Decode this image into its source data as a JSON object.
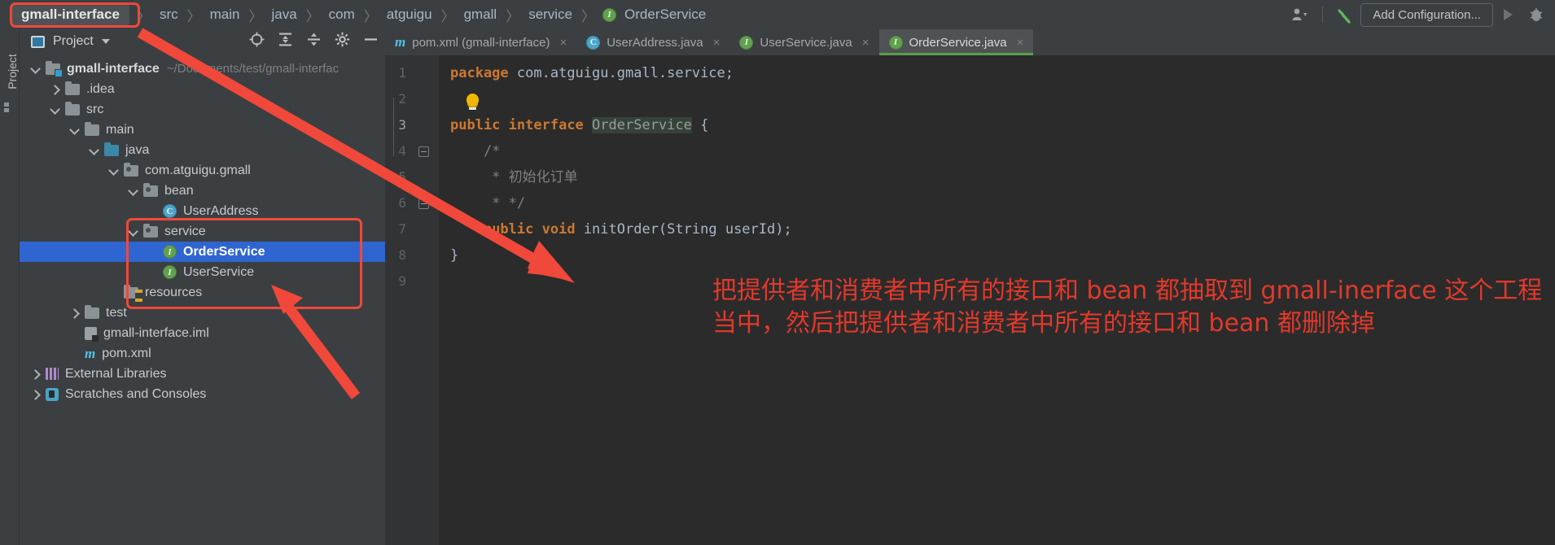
{
  "toolbar": {
    "breadcrumbs": [
      {
        "label": "gmall-interface",
        "icon": "",
        "root": true
      },
      {
        "label": "src",
        "icon": ""
      },
      {
        "label": "main",
        "icon": ""
      },
      {
        "label": "java",
        "icon": ""
      },
      {
        "label": "com",
        "icon": ""
      },
      {
        "label": "atguigu",
        "icon": ""
      },
      {
        "label": "gmall",
        "icon": ""
      },
      {
        "label": "service",
        "icon": ""
      },
      {
        "label": "OrderService",
        "icon": "interface-icon"
      }
    ],
    "user_icon": "user-dropdown-icon",
    "build_icon": "build-hammer-icon",
    "add_configuration_label": "Add Configuration...",
    "run_icon": "run-triangle-icon",
    "debug_icon": "debug-bug-icon"
  },
  "toolstrip": {
    "vertical_label": "Project",
    "structure_icon": "structure-icon"
  },
  "project_panel": {
    "title": "Project",
    "window_icon": "project-window-icon",
    "caret_icon": "chevron-down-icon",
    "actions": [
      {
        "name": "scroll-from-source-icon",
        "glyph": "target"
      },
      {
        "name": "expand-all-icon",
        "glyph": "expand"
      },
      {
        "name": "collapse-all-icon",
        "glyph": "collapse"
      },
      {
        "name": "settings-gear-icon",
        "glyph": "gear"
      },
      {
        "name": "hide-panel-icon",
        "glyph": "minus"
      }
    ],
    "tree": [
      {
        "label": "gmall-interface",
        "path": "~/Documents/test/gmall-interfac",
        "depth": 0,
        "arrow": "down",
        "icon": "module-folder",
        "bold": true,
        "selected": false
      },
      {
        "label": ".idea",
        "path": "",
        "depth": 1,
        "arrow": "right",
        "icon": "folder",
        "bold": false,
        "selected": false
      },
      {
        "label": "src",
        "path": "",
        "depth": 1,
        "arrow": "down",
        "icon": "folder",
        "bold": false,
        "selected": false
      },
      {
        "label": "main",
        "path": "",
        "depth": 2,
        "arrow": "down",
        "icon": "folder",
        "bold": false,
        "selected": false
      },
      {
        "label": "java",
        "path": "",
        "depth": 3,
        "arrow": "down",
        "icon": "source-folder",
        "bold": false,
        "selected": false
      },
      {
        "label": "com.atguigu.gmall",
        "path": "",
        "depth": 4,
        "arrow": "down",
        "icon": "package-folder",
        "bold": false,
        "selected": false
      },
      {
        "label": "bean",
        "path": "",
        "depth": 5,
        "arrow": "down",
        "icon": "package-folder",
        "bold": false,
        "selected": false
      },
      {
        "label": "UserAddress",
        "path": "",
        "depth": 6,
        "arrow": "none",
        "icon": "class-icon",
        "bold": false,
        "selected": false
      },
      {
        "label": "service",
        "path": "",
        "depth": 5,
        "arrow": "down",
        "icon": "package-folder",
        "bold": false,
        "selected": false
      },
      {
        "label": "OrderService",
        "path": "",
        "depth": 6,
        "arrow": "none",
        "icon": "interface-icon",
        "bold": true,
        "selected": true
      },
      {
        "label": "UserService",
        "path": "",
        "depth": 6,
        "arrow": "none",
        "icon": "interface-icon",
        "bold": false,
        "selected": false
      },
      {
        "label": "resources",
        "path": "",
        "depth": 4,
        "arrow": "none",
        "icon": "resources-folder",
        "bold": false,
        "selected": false
      },
      {
        "label": "test",
        "path": "",
        "depth": 2,
        "arrow": "right",
        "icon": "folder",
        "bold": false,
        "selected": false
      },
      {
        "label": "gmall-interface.iml",
        "path": "",
        "depth": 2,
        "arrow": "none",
        "icon": "iml-file",
        "bold": false,
        "selected": false
      },
      {
        "label": "pom.xml",
        "path": "",
        "depth": 2,
        "arrow": "none",
        "icon": "maven-icon",
        "bold": false,
        "selected": false
      },
      {
        "label": "External Libraries",
        "path": "",
        "depth": 0,
        "arrow": "right",
        "icon": "library-icon",
        "bold": false,
        "selected": false
      },
      {
        "label": "Scratches and Consoles",
        "path": "",
        "depth": 0,
        "arrow": "right",
        "icon": "scratch-icon",
        "bold": false,
        "selected": false
      }
    ]
  },
  "editor": {
    "tabs": [
      {
        "label": "pom.xml (gmall-interface)",
        "icon": "maven-icon",
        "active": false
      },
      {
        "label": "UserAddress.java",
        "icon": "class-icon",
        "active": false
      },
      {
        "label": "UserService.java",
        "icon": "interface-icon",
        "active": false
      },
      {
        "label": "OrderService.java",
        "icon": "interface-icon",
        "active": true
      }
    ],
    "close_glyph": "×",
    "line_numbers": [
      "1",
      "2",
      "3",
      "4",
      "5",
      "6",
      "7",
      "8",
      "9"
    ],
    "lines": [
      {
        "n": "1",
        "segments": [
          {
            "t": "package",
            "c": "kw"
          },
          {
            "t": " ",
            "c": "plain"
          },
          {
            "t": "com.atguigu.gmall.service;",
            "c": "plain"
          }
        ]
      },
      {
        "n": "2",
        "segments": [],
        "bulb": true
      },
      {
        "n": "3",
        "segments": [
          {
            "t": "public",
            "c": "kw"
          },
          {
            "t": " ",
            "c": "plain"
          },
          {
            "t": "interface",
            "c": "kw"
          },
          {
            "t": " ",
            "c": "plain"
          },
          {
            "t": "OrderService",
            "c": "id-hl"
          },
          {
            "t": " {",
            "c": "plain"
          }
        ]
      },
      {
        "n": "4",
        "segments": [
          {
            "t": "    /*",
            "c": "cmt"
          }
        ]
      },
      {
        "n": "5",
        "segments": [
          {
            "t": "     * 初始化订单",
            "c": "cmt"
          }
        ]
      },
      {
        "n": "6",
        "segments": [
          {
            "t": "     * */",
            "c": "cmt"
          }
        ]
      },
      {
        "n": "7",
        "segments": [
          {
            "t": "    ",
            "c": "plain"
          },
          {
            "t": "public",
            "c": "kw"
          },
          {
            "t": " ",
            "c": "plain"
          },
          {
            "t": "void",
            "c": "kw"
          },
          {
            "t": " initOrder(",
            "c": "plain"
          },
          {
            "t": "String",
            "c": "plain"
          },
          {
            "t": " userId);",
            "c": "plain"
          }
        ]
      },
      {
        "n": "8",
        "segments": [
          {
            "t": "}",
            "c": "plain"
          }
        ]
      },
      {
        "n": "9",
        "segments": []
      }
    ]
  },
  "annotations": {
    "note_text": "把提供者和消费者中所有的接口和 bean 都抽取到 gmall-inerface 这个工程当中，然后把提供者和消费者中所有的接口和 bean 都删除掉",
    "color": "#e2392b",
    "highlight_color": "#f0483a"
  }
}
